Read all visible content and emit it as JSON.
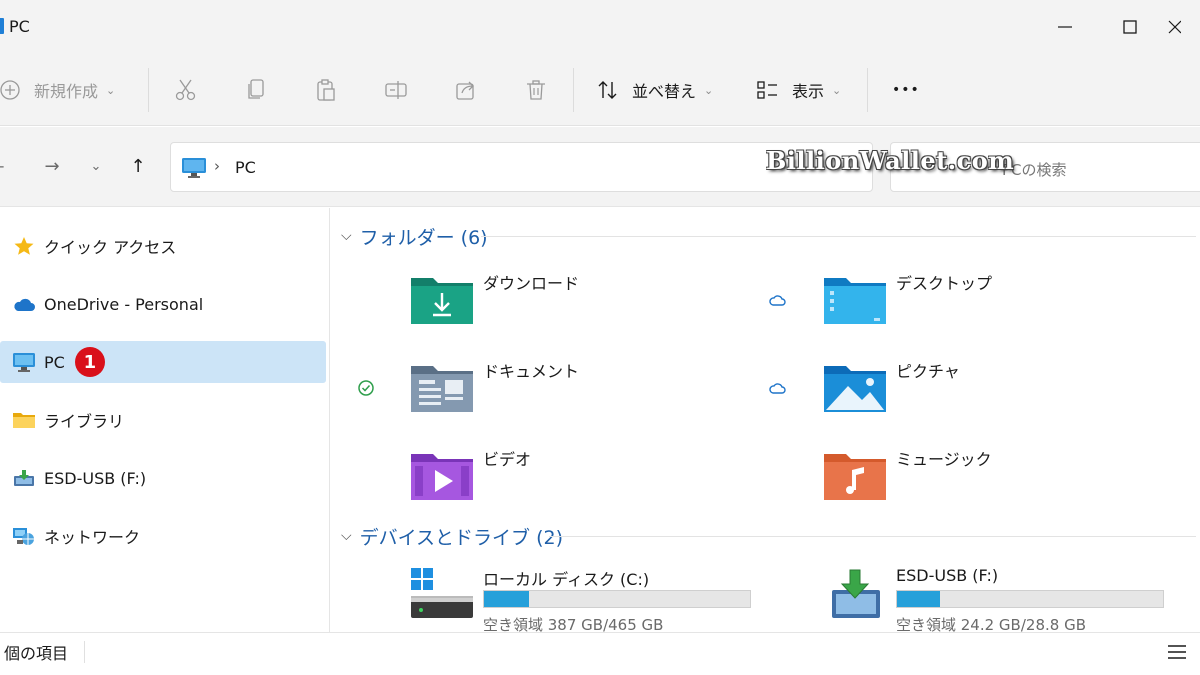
{
  "window": {
    "title": "PC"
  },
  "toolbar": {
    "new_label": "新規作成",
    "sort_label": "並べ替え",
    "view_label": "表示",
    "more_label": "•••"
  },
  "address": {
    "path": "PC",
    "search_placeholder": "PCの検索",
    "watermark": "BillionWallet.com"
  },
  "sidebar": {
    "items": [
      {
        "label": "クイック アクセス",
        "icon": "star-icon"
      },
      {
        "label": "OneDrive - Personal",
        "icon": "cloud-icon"
      },
      {
        "label": "PC",
        "icon": "monitor-icon",
        "selected": true,
        "badge": "1"
      },
      {
        "label": "ライブラリ",
        "icon": "folder-icon"
      },
      {
        "label": "ESD-USB (F:)",
        "icon": "usb-drive-icon"
      },
      {
        "label": "ネットワーク",
        "icon": "network-icon"
      }
    ]
  },
  "main": {
    "folders_header": "フォルダー (6)",
    "folders": [
      {
        "name": "ダウンロード",
        "icon": "downloads-folder-icon",
        "status": ""
      },
      {
        "name": "デスクトップ",
        "icon": "desktop-folder-icon",
        "status": "cloud"
      },
      {
        "name": "ドキュメント",
        "icon": "documents-folder-icon",
        "status": "synced"
      },
      {
        "name": "ピクチャ",
        "icon": "pictures-folder-icon",
        "status": "cloud"
      },
      {
        "name": "ビデオ",
        "icon": "videos-folder-icon",
        "status": ""
      },
      {
        "name": "ミュージック",
        "icon": "music-folder-icon",
        "status": ""
      }
    ],
    "drives_header": "デバイスとドライブ (2)",
    "drives": [
      {
        "name": "ローカル ディスク (C:)",
        "free": "空き領域 387 GB/465 GB",
        "used_fraction": 0.17
      },
      {
        "name": "ESD-USB (F:)",
        "free": "空き領域 24.2 GB/28.8 GB",
        "used_fraction": 0.16
      }
    ]
  },
  "status": {
    "items_text": "個の項目"
  },
  "colors": {
    "accent": "#1f5fa8",
    "selection": "#cce4f7",
    "bar_fill": "#26a0da",
    "badge": "#d9101a"
  }
}
